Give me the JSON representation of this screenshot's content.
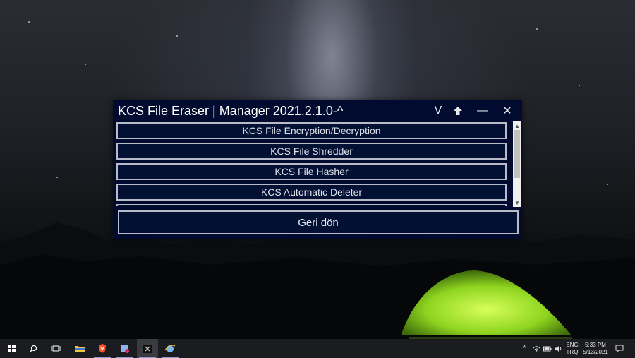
{
  "window": {
    "title": "KCS File Eraser | Manager 2021.2.1.0-^",
    "controls": {
      "dropdown_glyph": "V",
      "pin_icon": "pin-up-arrow-icon",
      "minimize_glyph": "—",
      "close_glyph": "✕"
    },
    "menu_items": [
      {
        "label": "KCS File Encryption/Decryption"
      },
      {
        "label": "KCS File Shredder"
      },
      {
        "label": "KCS File Hasher"
      },
      {
        "label": "KCS Automatic Deleter"
      }
    ],
    "back_button": "Geri dön",
    "colors": {
      "background": "#010b2f",
      "border": "#b9bcc8",
      "text": "#ffffff"
    }
  },
  "taskbar": {
    "icons": [
      "windows-start-icon",
      "search-icon",
      "task-view-icon",
      "file-explorer-icon",
      "brave-browser-icon",
      "app-icon",
      "kcs-app-icon",
      "ie-app-icon"
    ],
    "tray": {
      "language_top": "ENG",
      "language_bottom": "TRQ",
      "time": "5:33 PM",
      "date": "5/13/2021"
    }
  }
}
